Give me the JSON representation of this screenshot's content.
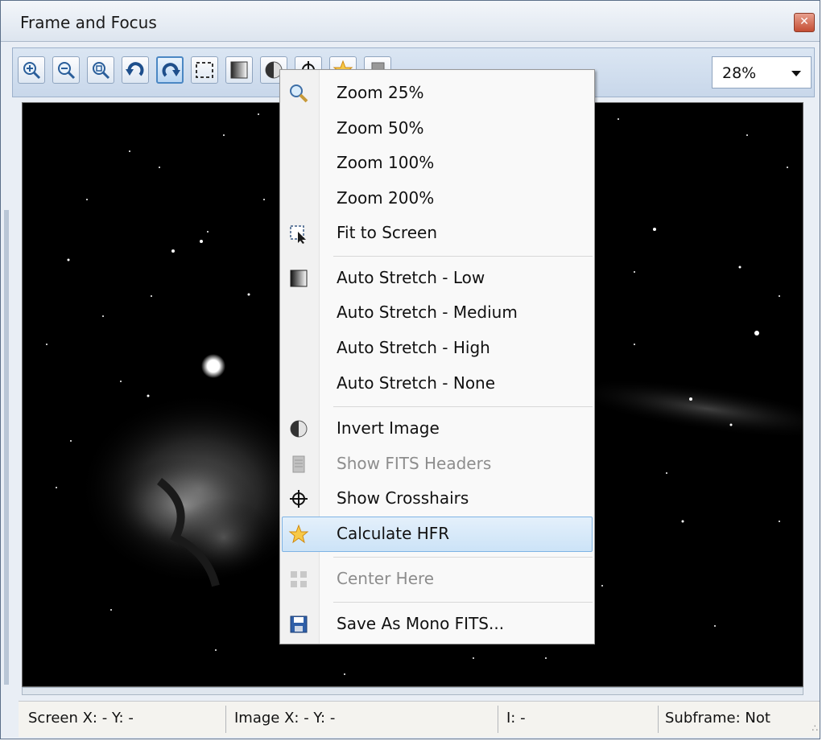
{
  "window": {
    "title": "Frame and Focus",
    "close_glyph": "✕"
  },
  "toolbar": {
    "buttons": [
      {
        "name": "zoom-in-icon"
      },
      {
        "name": "zoom-out-icon"
      },
      {
        "name": "zoom-fit-icon"
      },
      {
        "name": "rotate-left-icon"
      },
      {
        "name": "rotate-right-icon"
      },
      {
        "name": "selection-icon"
      },
      {
        "name": "stretch-icon"
      },
      {
        "name": "invert-icon"
      },
      {
        "name": "crosshair-icon"
      },
      {
        "name": "star-icon"
      },
      {
        "name": "fits-header-icon"
      }
    ],
    "zoom_value": "28%"
  },
  "context_menu": {
    "items": [
      {
        "label": "Zoom 25%",
        "icon": "magnifier-icon"
      },
      {
        "label": "Zoom 50%",
        "icon": ""
      },
      {
        "label": "Zoom 100%",
        "icon": ""
      },
      {
        "label": "Zoom 200%",
        "icon": ""
      },
      {
        "label": "Fit to Screen",
        "icon": "fit-screen-icon"
      },
      {
        "label": "Auto Stretch - Low",
        "icon": "gradient-icon"
      },
      {
        "label": "Auto Stretch - Medium",
        "icon": ""
      },
      {
        "label": "Auto Stretch - High",
        "icon": ""
      },
      {
        "label": "Auto Stretch - None",
        "icon": ""
      },
      {
        "label": "Invert Image",
        "icon": "half-circle-icon"
      },
      {
        "label": "Show FITS Headers",
        "icon": "document-icon",
        "disabled": true
      },
      {
        "label": "Show Crosshairs",
        "icon": "crosshair-icon"
      },
      {
        "label": "Calculate HFR",
        "icon": "star-icon",
        "highlighted": true
      },
      {
        "label": "Center Here",
        "icon": "center-icon",
        "disabled": true
      },
      {
        "label": "Save As Mono FITS...",
        "icon": "save-icon"
      }
    ]
  },
  "status": {
    "screen": "Screen X: - Y: -",
    "image": "Image X: - Y: -",
    "intensity": "I: -",
    "subframe": "Subframe: Not"
  },
  "colors": {
    "accent": "#4b87c3",
    "highlight": "#cce3f7",
    "title": "#1a1a1a"
  }
}
